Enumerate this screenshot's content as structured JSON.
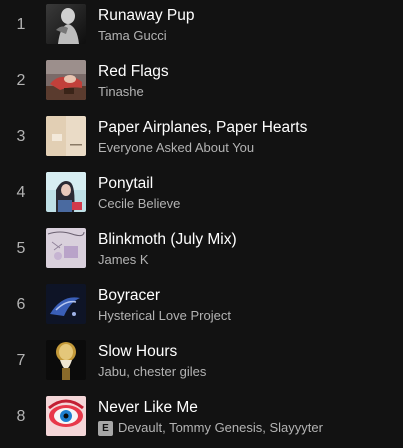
{
  "tracks": [
    {
      "number": "1",
      "title": "Runaway Pup",
      "artist": "Tama Gucci",
      "explicit": false,
      "cover_icon": "album-cover-dark-figure"
    },
    {
      "number": "2",
      "title": "Red Flags",
      "artist": "Tinashe",
      "explicit": false,
      "cover_icon": "album-cover-red-figure"
    },
    {
      "number": "3",
      "title": "Paper Airplanes, Paper Hearts",
      "artist": "Everyone Asked About You",
      "explicit": false,
      "cover_icon": "album-cover-beige"
    },
    {
      "number": "4",
      "title": "Ponytail",
      "artist": "Cecile Believe",
      "explicit": false,
      "cover_icon": "album-cover-teal-portrait"
    },
    {
      "number": "5",
      "title": "Blinkmoth (July Mix)",
      "artist": "James K",
      "explicit": false,
      "cover_icon": "album-cover-lilac"
    },
    {
      "number": "6",
      "title": "Boyracer",
      "artist": "Hysterical Love Project",
      "explicit": false,
      "cover_icon": "album-cover-blue-swirl"
    },
    {
      "number": "7",
      "title": "Slow Hours",
      "artist": "Jabu, chester giles",
      "explicit": false,
      "cover_icon": "album-cover-gold-mask"
    },
    {
      "number": "8",
      "title": "Never Like Me",
      "artist": "Devault, Tommy Genesis, Slayyyter",
      "explicit": true,
      "explicit_label": "E",
      "cover_icon": "album-cover-red-eye"
    }
  ],
  "colors": {
    "background": "#121212",
    "primary_text": "#ffffff",
    "secondary_text": "#b3b3b3"
  }
}
